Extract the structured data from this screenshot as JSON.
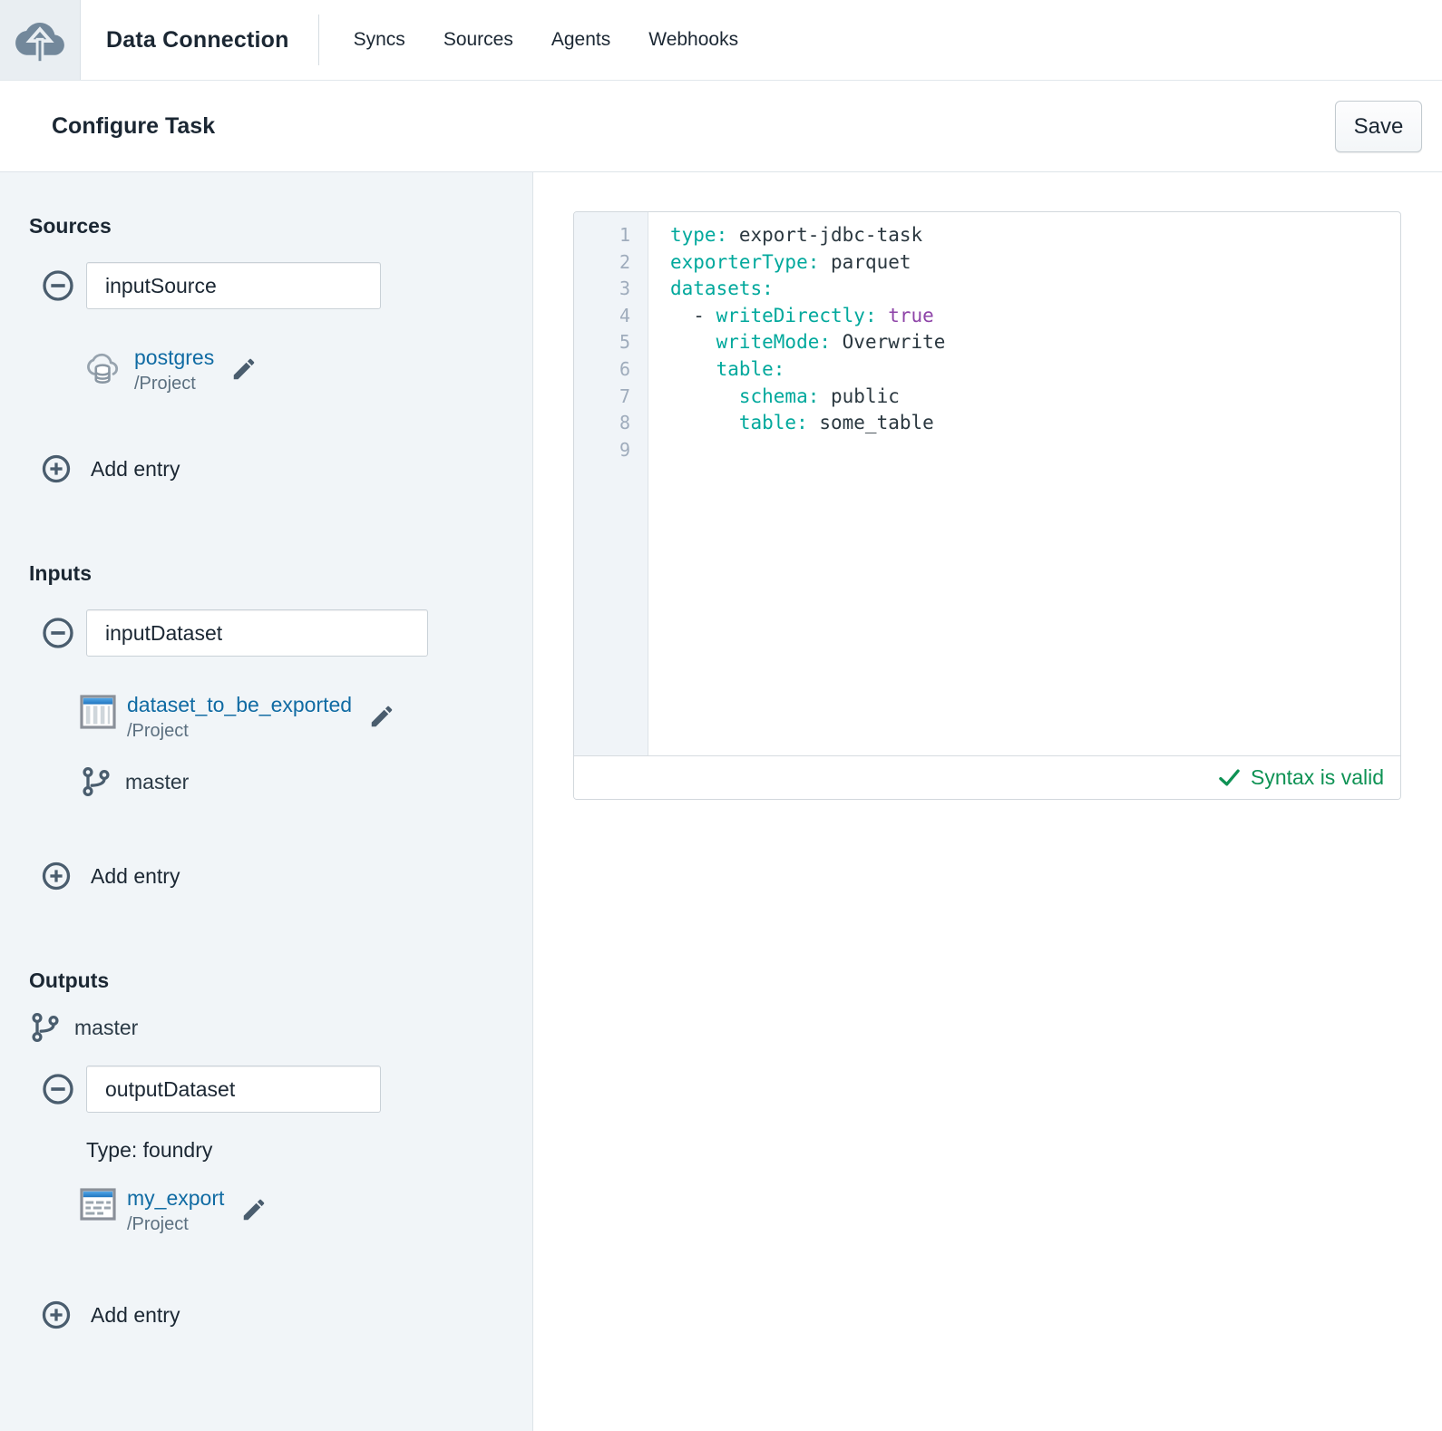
{
  "header": {
    "app_title": "Data Connection",
    "nav_items": [
      {
        "label": "Syncs"
      },
      {
        "label": "Sources"
      },
      {
        "label": "Agents"
      },
      {
        "label": "Webhooks"
      }
    ]
  },
  "toolbar": {
    "title": "Configure Task",
    "save_label": "Save"
  },
  "sidebar": {
    "sources": {
      "heading": "Sources",
      "entry": {
        "name_value": "inputSource",
        "resource_name": "postgres",
        "resource_path": "/Project"
      },
      "add_label": "Add entry"
    },
    "inputs": {
      "heading": "Inputs",
      "entry": {
        "name_value": "inputDataset",
        "resource_name": "dataset_to_be_exported",
        "resource_path": "/Project",
        "branch": "master"
      },
      "add_label": "Add entry"
    },
    "outputs": {
      "heading": "Outputs",
      "branch": "master",
      "entry": {
        "name_value": "outputDataset",
        "type_label": "Type: foundry",
        "resource_name": "my_export",
        "resource_path": "/Project"
      },
      "add_label": "Add entry"
    }
  },
  "editor": {
    "language": "yaml",
    "status": "Syntax is valid",
    "lines": [
      {
        "n": "1",
        "tokens": [
          [
            "k",
            "type:"
          ],
          [
            "p",
            " export-jdbc-task"
          ]
        ]
      },
      {
        "n": "2",
        "tokens": [
          [
            "k",
            "exporterType:"
          ],
          [
            "p",
            " parquet"
          ]
        ]
      },
      {
        "n": "3",
        "tokens": [
          [
            "k",
            "datasets:"
          ]
        ]
      },
      {
        "n": "4",
        "tokens": [
          [
            "p",
            "  - "
          ],
          [
            "k",
            "writeDirectly:"
          ],
          [
            "p",
            " "
          ],
          [
            "a",
            "true"
          ]
        ]
      },
      {
        "n": "5",
        "tokens": [
          [
            "p",
            "    "
          ],
          [
            "k",
            "writeMode:"
          ],
          [
            "p",
            " Overwrite"
          ]
        ]
      },
      {
        "n": "6",
        "tokens": [
          [
            "p",
            "    "
          ],
          [
            "k",
            "table:"
          ]
        ]
      },
      {
        "n": "7",
        "tokens": [
          [
            "p",
            "      "
          ],
          [
            "k",
            "schema:"
          ],
          [
            "p",
            " public"
          ]
        ]
      },
      {
        "n": "8",
        "tokens": [
          [
            "p",
            "      "
          ],
          [
            "k",
            "table:"
          ],
          [
            "p",
            " some_table"
          ]
        ]
      },
      {
        "n": "9",
        "tokens": []
      }
    ]
  },
  "colors": {
    "link_blue": "#106BA3",
    "yaml_key_teal": "#00A89C",
    "yaml_atom_purple": "#8E44A8",
    "syntax_valid_green": "#0E9254",
    "sidebar_bg": "#F1F5F8",
    "icon_slate": "#4A5D6E"
  }
}
